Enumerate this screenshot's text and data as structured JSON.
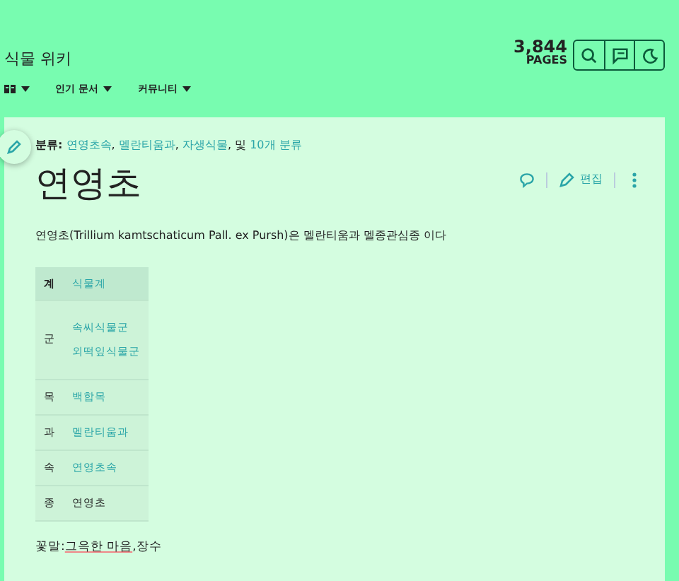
{
  "header": {
    "site_title": "식물 위키",
    "page_count": "3,844",
    "page_count_label": "PAGES",
    "nav": [
      {
        "kind": "icon"
      },
      {
        "label": "인기 문서",
        "kind": "text"
      },
      {
        "label": "커뮤니티",
        "kind": "text"
      }
    ],
    "tools": [
      {
        "kind": "search"
      },
      {
        "kind": "discuss"
      },
      {
        "kind": "theme"
      }
    ]
  },
  "article": {
    "categories_label": "분류:",
    "categories": [
      {
        "text": "연영초속",
        "sep": ", "
      },
      {
        "text": "멜란티움과",
        "sep": ", "
      },
      {
        "text": "자생식물",
        "sep": ", 및 "
      },
      {
        "text": "10개 분류"
      }
    ],
    "title": "연영초",
    "edit_label": "편집",
    "intro": "연영초(Trillium kamtschaticum Pall. ex Pursh)은 멜란티움과 멜종관심종 이다",
    "taxobox": [
      {
        "rank": "계",
        "header": true,
        "values": [
          {
            "text": "식물계",
            "link": true
          }
        ]
      },
      {
        "rank": "군",
        "header": false,
        "values": [
          {
            "text": "속씨식물군",
            "link": true
          },
          {
            "text": "외떡잎식물군",
            "link": true
          }
        ]
      },
      {
        "rank": "목",
        "header": false,
        "values": [
          {
            "text": "백합목",
            "link": true
          }
        ]
      },
      {
        "rank": "과",
        "header": false,
        "values": [
          {
            "text": "멜란티움과",
            "link": true
          }
        ]
      },
      {
        "rank": "속",
        "header": false,
        "values": [
          {
            "text": "연영초속",
            "link": true
          }
        ]
      },
      {
        "rank": "종",
        "header": false,
        "values": [
          {
            "text": "연영초",
            "link": false
          }
        ]
      }
    ],
    "flower_language": [
      {
        "text": "꽃말:",
        "underlined": false
      },
      {
        "text": "그윽한 마음",
        "underlined": true
      },
      {
        "text": ",장수",
        "underlined": false
      }
    ]
  }
}
